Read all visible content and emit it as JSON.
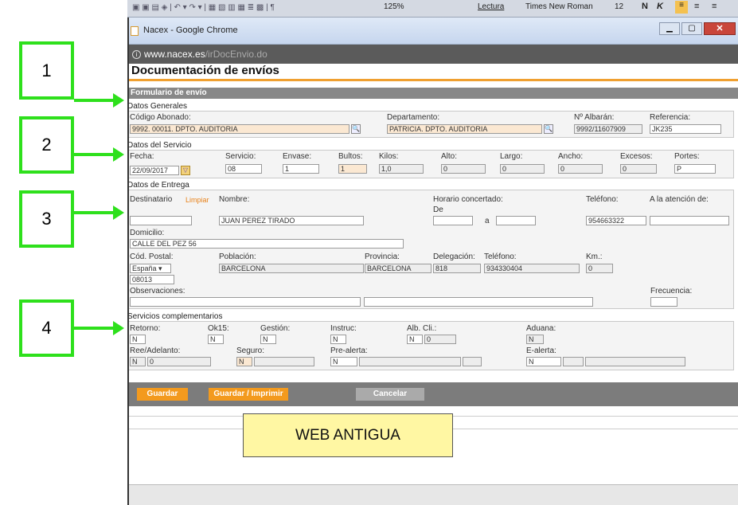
{
  "annotations": {
    "box1": "1",
    "box2": "2",
    "box3": "3",
    "box4": "4",
    "banner": "WEB ANTIGUA"
  },
  "office_toolbar": {
    "zoom": "125%",
    "reading": "Lectura",
    "font_name": "Times New Roman",
    "font_size": "12"
  },
  "browser": {
    "title": "Nacex - Google Chrome",
    "url_host": "www.nacex.es",
    "url_path": "/irDocEnvio.do"
  },
  "page": {
    "title": "Documentación de envíos",
    "form_header": "Formulario de envío"
  },
  "datos_generales": {
    "title": "Datos Generales",
    "codigo_abonado_label": "Código Abonado:",
    "codigo_abonado_value": "9992. 00011. DPTO. AUDITORIA",
    "departamento_label": "Departamento:",
    "departamento_value": "PATRICIA. DPTO. AUDITORIA",
    "albaran_label": "Nº Albarán:",
    "albaran_value": "9992/11607909",
    "referencia_label": "Referencia:",
    "referencia_value": "JK235"
  },
  "datos_servicio": {
    "title": "Datos del Servicio",
    "fecha_label": "Fecha:",
    "fecha_value": "22/09/2017",
    "servicio_label": "Servicio:",
    "servicio_value": "08",
    "envase_label": "Envase:",
    "envase_value": "1",
    "bultos_label": "Bultos:",
    "bultos_value": "1",
    "kilos_label": "Kilos:",
    "kilos_value": "1,0",
    "alto_label": "Alto:",
    "alto_value": "0",
    "largo_label": "Largo:",
    "largo_value": "0",
    "ancho_label": "Ancho:",
    "ancho_value": "0",
    "excesos_label": "Excesos:",
    "excesos_value": "0",
    "portes_label": "Portes:",
    "portes_value": "P"
  },
  "datos_entrega": {
    "title": "Datos de Entrega",
    "destinatario_label": "Destinatario",
    "limpiar": "Limpiar",
    "nombre_label": "Nombre:",
    "nombre_value": "JUAN PEREZ TIRADO",
    "horario_label": "Horario concertado:",
    "de_label": "De",
    "a_label": "a",
    "telefono_label": "Teléfono:",
    "telefono_value": "954663322",
    "atencion_label": "A la atención de:",
    "domicilio_label": "Domicilio:",
    "domicilio_value": "CALLE DEL PEZ 56",
    "cod_postal_label": "Cód. Postal:",
    "pais_value": "España",
    "cp_value": "08013",
    "poblacion_label": "Población:",
    "poblacion_value": "BARCELONA",
    "provincia_label": "Provincia:",
    "provincia_value": "BARCELONA",
    "delegacion_label": "Delegación:",
    "delegacion_value": "818",
    "telefono2_label": "Teléfono:",
    "telefono2_value": "934330404",
    "km_label": "Km.:",
    "km_value": "0",
    "observaciones_label": "Observaciones:",
    "frecuencia_label": "Frecuencia:"
  },
  "servicios": {
    "title": "Servicios complementarios",
    "retorno_label": "Retorno:",
    "retorno_value": "N",
    "ok15_label": "Ok15:",
    "ok15_value": "N",
    "gestion_label": "Gestión:",
    "gestion_value": "N",
    "instruc_label": "Instruc:",
    "instruc_value": "N",
    "albcli_label": "Alb. Cli.:",
    "albcli_value": "N",
    "albcli_num": "0",
    "aduana_label": "Aduana:",
    "aduana_value": "N",
    "ree_label": "Ree/Adelanto:",
    "ree_value": "N",
    "ree_num": "0",
    "seguro_label": "Seguro:",
    "seguro_value": "N",
    "prealerta_label": "Pre-alerta:",
    "prealerta_value": "N",
    "ealerta_label": "E-alerta:",
    "ealerta_value": "N"
  },
  "buttons": {
    "guardar": "Guardar",
    "guardar_imprimir": "Guardar / Imprimir",
    "cancelar": "Cancelar"
  }
}
